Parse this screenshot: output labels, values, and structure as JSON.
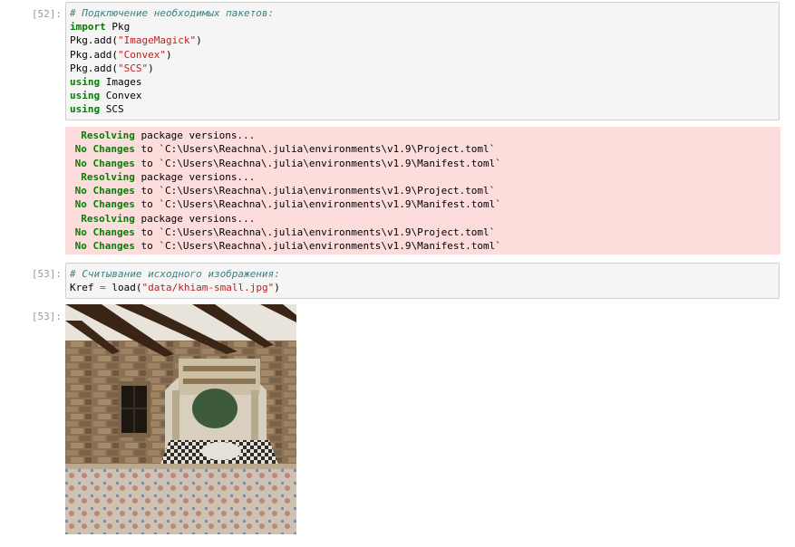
{
  "cells": [
    {
      "prompt": "[52]:",
      "lines": [
        [
          {
            "t": "# Подключение необходимых пакетов:",
            "c": "cm"
          }
        ],
        [
          {
            "t": "import",
            "c": "kw"
          },
          {
            "t": " Pkg",
            "c": ""
          }
        ],
        [
          {
            "t": "Pkg.add(",
            "c": ""
          },
          {
            "t": "\"ImageMagick\"",
            "c": "str"
          },
          {
            "t": ")",
            "c": ""
          }
        ],
        [
          {
            "t": "Pkg.add(",
            "c": ""
          },
          {
            "t": "\"Convex\"",
            "c": "str"
          },
          {
            "t": ")",
            "c": ""
          }
        ],
        [
          {
            "t": "Pkg.add(",
            "c": ""
          },
          {
            "t": "\"SCS\"",
            "c": "str"
          },
          {
            "t": ")",
            "c": ""
          }
        ],
        [
          {
            "t": "using",
            "c": "kw"
          },
          {
            "t": " Images",
            "c": ""
          }
        ],
        [
          {
            "t": "using",
            "c": "kw"
          },
          {
            "t": " Convex",
            "c": ""
          }
        ],
        [
          {
            "t": "using",
            "c": "kw"
          },
          {
            "t": " SCS",
            "c": ""
          }
        ]
      ],
      "output_lines": [
        [
          {
            "t": "  Resolving",
            "c": "g"
          },
          {
            "t": " package versions...",
            "c": ""
          }
        ],
        [
          {
            "t": " No Changes",
            "c": "g"
          },
          {
            "t": " to `C:\\Users\\Reachna\\.julia\\environments\\v1.9\\Project.toml`",
            "c": ""
          }
        ],
        [
          {
            "t": " No Changes",
            "c": "g"
          },
          {
            "t": " to `C:\\Users\\Reachna\\.julia\\environments\\v1.9\\Manifest.toml`",
            "c": ""
          }
        ],
        [
          {
            "t": "  Resolving",
            "c": "g"
          },
          {
            "t": " package versions...",
            "c": ""
          }
        ],
        [
          {
            "t": " No Changes",
            "c": "g"
          },
          {
            "t": " to `C:\\Users\\Reachna\\.julia\\environments\\v1.9\\Project.toml`",
            "c": ""
          }
        ],
        [
          {
            "t": " No Changes",
            "c": "g"
          },
          {
            "t": " to `C:\\Users\\Reachna\\.julia\\environments\\v1.9\\Manifest.toml`",
            "c": ""
          }
        ],
        [
          {
            "t": "  Resolving",
            "c": "g"
          },
          {
            "t": " package versions...",
            "c": ""
          }
        ],
        [
          {
            "t": " No Changes",
            "c": "g"
          },
          {
            "t": " to `C:\\Users\\Reachna\\.julia\\environments\\v1.9\\Project.toml`",
            "c": ""
          }
        ],
        [
          {
            "t": " No Changes",
            "c": "g"
          },
          {
            "t": " to `C:\\Users\\Reachna\\.julia\\environments\\v1.9\\Manifest.toml`",
            "c": ""
          }
        ]
      ]
    },
    {
      "prompt": "[53]:",
      "lines": [
        [
          {
            "t": "# Считывание исходного изображения:",
            "c": "cm"
          }
        ],
        [
          {
            "t": "Kref ",
            "c": ""
          },
          {
            "t": "=",
            "c": "op"
          },
          {
            "t": " load(",
            "c": ""
          },
          {
            "t": "\"data/khiam-small.jpg\"",
            "c": "str"
          },
          {
            "t": ")",
            "c": ""
          }
        ]
      ],
      "output_prompt": "[53]:",
      "output_image": "photo of interior room with stone walls, wooden ceiling beams, mosaic mural and patterned tile floor"
    }
  ],
  "colors": {
    "keyword": "#008000",
    "string": "#ba2121",
    "comment": "#408080",
    "stderr_bg": "#fddcdc",
    "cell_bg": "#f5f5f5"
  }
}
